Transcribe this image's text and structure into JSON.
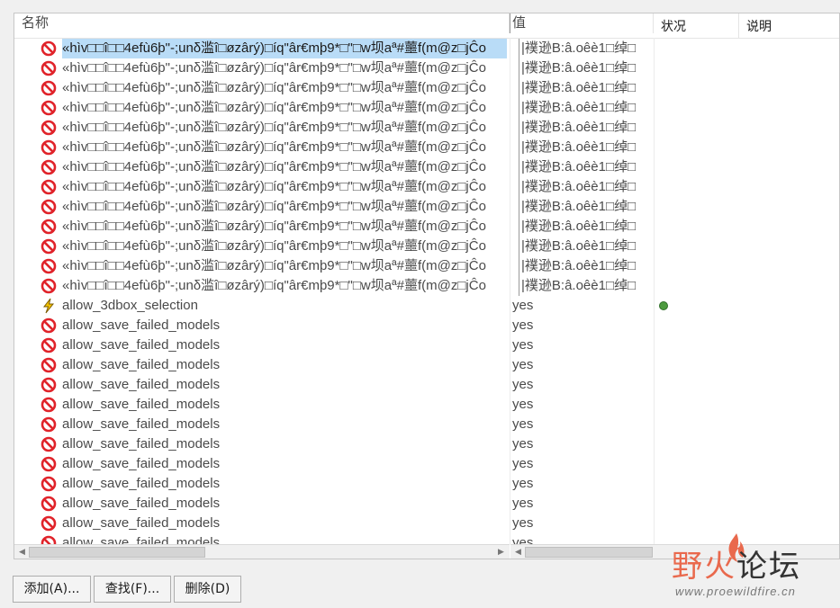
{
  "columns": {
    "name": "名称",
    "value": "值",
    "status": "状况",
    "description": "说明"
  },
  "rows": [
    {
      "icon": "no-entry-icon",
      "name": "«hìv□□î□□4efù6þ\"-;unδ滥î□øzârý)□íq\"âr€mþ9*□\"□w坝aª#蘁f(m@z□jĈo",
      "value": "|襆逊B:â.oêè1□绰□",
      "status": "",
      "selected": true
    },
    {
      "icon": "no-entry-icon",
      "name": "«hìv□□î□□4efù6þ\"-;unδ滥î□øzârý)□íq\"âr€mþ9*□\"□w坝aª#蘁f(m@z□jĈo",
      "value": "|襆逊B:â.oêè1□绰□",
      "status": ""
    },
    {
      "icon": "no-entry-icon",
      "name": "«hìv□□î□□4efù6þ\"-;unδ滥î□øzârý)□íq\"âr€mþ9*□\"□w坝aª#蘁f(m@z□jĈo",
      "value": "|襆逊B:â.oêè1□绰□",
      "status": ""
    },
    {
      "icon": "no-entry-icon",
      "name": "«hìv□□î□□4efù6þ\"-;unδ滥î□øzârý)□íq\"âr€mþ9*□\"□w坝aª#蘁f(m@z□jĈo",
      "value": "|襆逊B:â.oêè1□绰□",
      "status": ""
    },
    {
      "icon": "no-entry-icon",
      "name": "«hìv□□î□□4efù6þ\"-;unδ滥î□øzârý)□íq\"âr€mþ9*□\"□w坝aª#蘁f(m@z□jĈo",
      "value": "|襆逊B:â.oêè1□绰□",
      "status": ""
    },
    {
      "icon": "no-entry-icon",
      "name": "«hìv□□î□□4efù6þ\"-;unδ滥î□øzârý)□íq\"âr€mþ9*□\"□w坝aª#蘁f(m@z□jĈo",
      "value": "|襆逊B:â.oêè1□绰□",
      "status": ""
    },
    {
      "icon": "no-entry-icon",
      "name": "«hìv□□î□□4efù6þ\"-;unδ滥î□øzârý)□íq\"âr€mþ9*□\"□w坝aª#蘁f(m@z□jĈo",
      "value": "|襆逊B:â.oêè1□绰□",
      "status": ""
    },
    {
      "icon": "no-entry-icon",
      "name": "«hìv□□î□□4efù6þ\"-;unδ滥î□øzârý)□íq\"âr€mþ9*□\"□w坝aª#蘁f(m@z□jĈo",
      "value": "|襆逊B:â.oêè1□绰□",
      "status": ""
    },
    {
      "icon": "no-entry-icon",
      "name": "«hìv□□î□□4efù6þ\"-;unδ滥î□øzârý)□íq\"âr€mþ9*□\"□w坝aª#蘁f(m@z□jĈo",
      "value": "|襆逊B:â.oêè1□绰□",
      "status": ""
    },
    {
      "icon": "no-entry-icon",
      "name": "«hìv□□î□□4efù6þ\"-;unδ滥î□øzârý)□íq\"âr€mþ9*□\"□w坝aª#蘁f(m@z□jĈo",
      "value": "|襆逊B:â.oêè1□绰□",
      "status": ""
    },
    {
      "icon": "no-entry-icon",
      "name": "«hìv□□î□□4efù6þ\"-;unδ滥î□øzârý)□íq\"âr€mþ9*□\"□w坝aª#蘁f(m@z□jĈo",
      "value": "|襆逊B:â.oêè1□绰□",
      "status": ""
    },
    {
      "icon": "no-entry-icon",
      "name": "«hìv□□î□□4efù6þ\"-;unδ滥î□øzârý)□íq\"âr€mþ9*□\"□w坝aª#蘁f(m@z□jĈo",
      "value": "|襆逊B:â.oêè1□绰□",
      "status": ""
    },
    {
      "icon": "no-entry-icon",
      "name": "«hìv□□î□□4efù6þ\"-;unδ滥î□øzârý)□íq\"âr€mþ9*□\"□w坝aª#蘁f(m@z□jĈo",
      "value": "|襆逊B:â.oêè1□绰□",
      "status": ""
    },
    {
      "icon": "lightning-icon",
      "name": "allow_3dbox_selection",
      "value": "yes",
      "status": "green-dot"
    },
    {
      "icon": "no-entry-icon",
      "name": "allow_save_failed_models",
      "value": "yes",
      "status": ""
    },
    {
      "icon": "no-entry-icon",
      "name": "allow_save_failed_models",
      "value": "yes",
      "status": ""
    },
    {
      "icon": "no-entry-icon",
      "name": "allow_save_failed_models",
      "value": "yes",
      "status": ""
    },
    {
      "icon": "no-entry-icon",
      "name": "allow_save_failed_models",
      "value": "yes",
      "status": ""
    },
    {
      "icon": "no-entry-icon",
      "name": "allow_save_failed_models",
      "value": "yes",
      "status": ""
    },
    {
      "icon": "no-entry-icon",
      "name": "allow_save_failed_models",
      "value": "yes",
      "status": ""
    },
    {
      "icon": "no-entry-icon",
      "name": "allow_save_failed_models",
      "value": "yes",
      "status": ""
    },
    {
      "icon": "no-entry-icon",
      "name": "allow_save_failed_models",
      "value": "yes",
      "status": ""
    },
    {
      "icon": "no-entry-icon",
      "name": "allow_save_failed_models",
      "value": "yes",
      "status": ""
    },
    {
      "icon": "no-entry-icon",
      "name": "allow_save_failed_models",
      "value": "yes",
      "status": ""
    },
    {
      "icon": "no-entry-icon",
      "name": "allow_save_failed_models",
      "value": "yes",
      "status": ""
    },
    {
      "icon": "no-entry-icon",
      "name": "allow_save_failed_models",
      "value": "yes",
      "status": ""
    }
  ],
  "buttons": {
    "add": "添加(A)...",
    "find": "查找(F)...",
    "delete": "删除(D)"
  },
  "watermark": {
    "cn_part1": "野火",
    "cn_part2": "论坛",
    "url": "www.proewildfire.cn"
  },
  "colors": {
    "no_entry": "#e0232a",
    "lightning": "#e8b400",
    "selection": "#b9dcf7",
    "status_ok": "#4c9a3e"
  }
}
